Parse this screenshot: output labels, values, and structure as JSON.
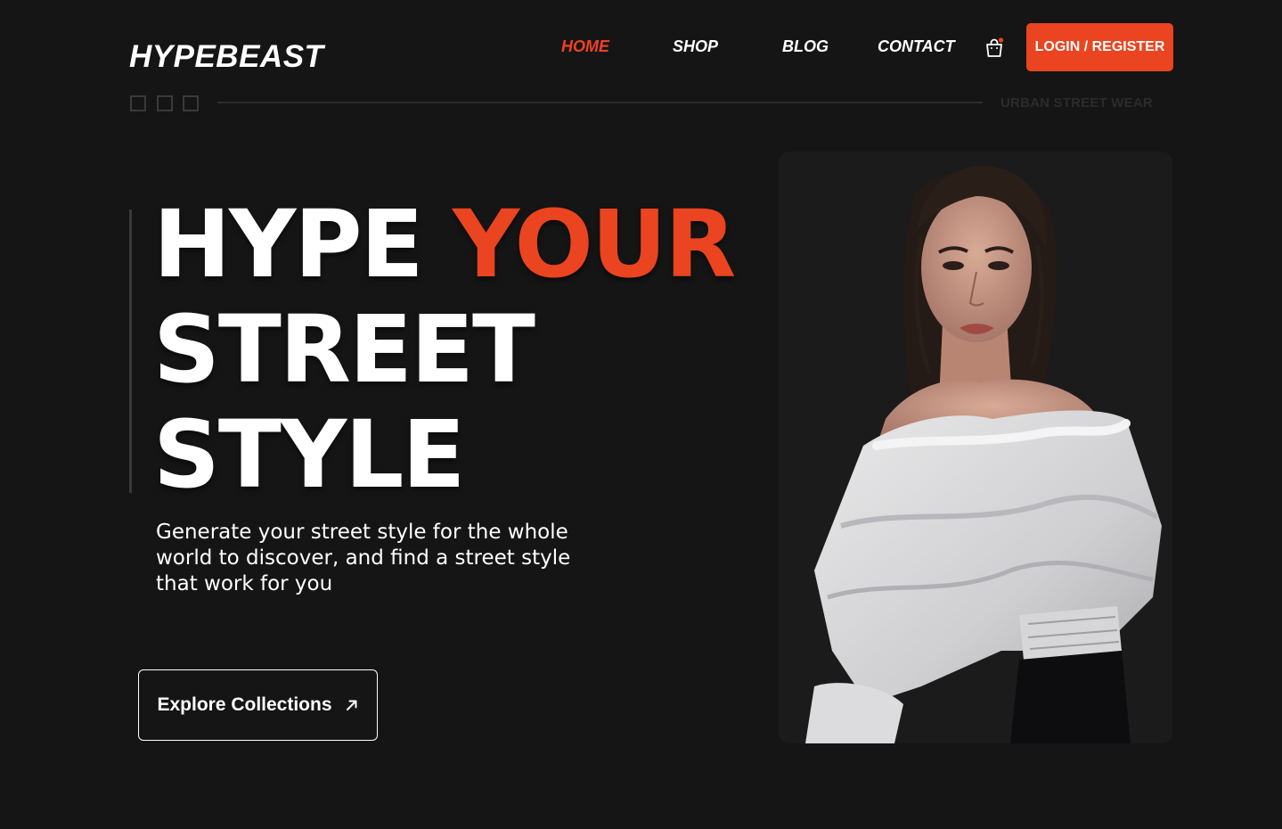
{
  "header": {
    "logo": "HYPEBEAST",
    "nav": [
      {
        "label": "HOME",
        "active": true
      },
      {
        "label": "SHOP",
        "active": false
      },
      {
        "label": "BLOG",
        "active": false
      },
      {
        "label": "CONTACT",
        "active": false
      }
    ],
    "cart_icon": "shopping-bag-icon",
    "login_label": "LOGIN / REGISTER"
  },
  "divider": {
    "tagline": "URBAN STREET WEAR"
  },
  "hero": {
    "line1_white": "HYPE",
    "line1_accent": "YOUR",
    "line2": "STREET",
    "line3": "STYLE",
    "description": "Generate your street style for the whole world to discover, and find a street style that work for you",
    "cta_label": "Explore Collections",
    "cta_icon": "arrow-up-right-icon"
  },
  "colors": {
    "background": "#151515",
    "accent": "#ea4420",
    "text": "#ffffff"
  }
}
